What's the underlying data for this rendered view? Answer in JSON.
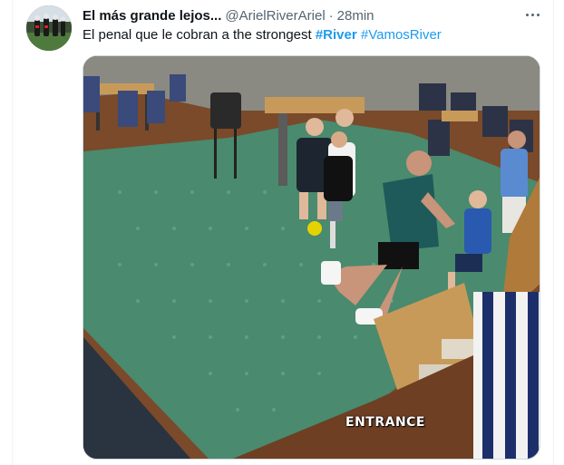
{
  "tweet": {
    "author_name": "El más grande lejos...",
    "author_handle": "@ArielRiverAriel",
    "separator": "·",
    "timestamp": "28min",
    "text_plain": "El penal que le cobran a the strongest",
    "hashtags": [
      "#River",
      "#VamosRiver"
    ]
  },
  "media": {
    "overlay_label": "ENTRANCE"
  },
  "icons": {
    "more": "more-horizontal-icon",
    "avatar": "avatar"
  },
  "colors": {
    "link": "#1d9bf0",
    "text": "#0f1419",
    "secondary": "#536471",
    "carpet": "#4a8a6e"
  }
}
